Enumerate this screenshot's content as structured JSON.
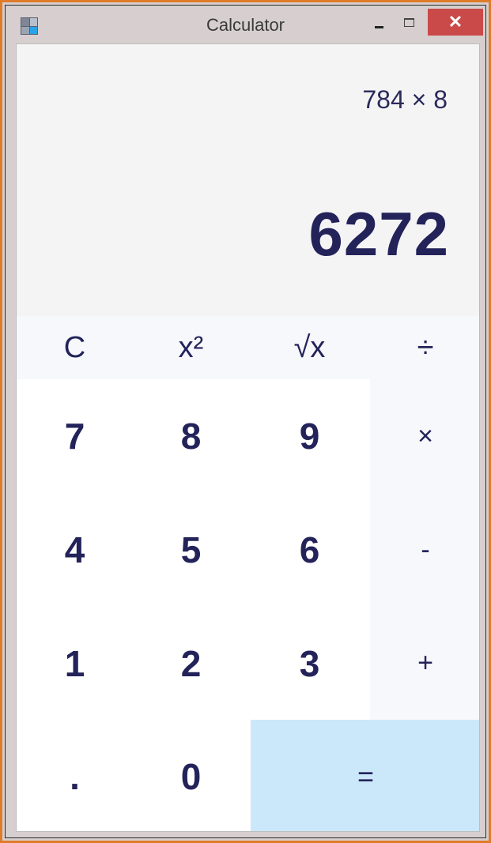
{
  "window": {
    "title": "Calculator",
    "close_label": "✕"
  },
  "display": {
    "expression": "784 × 8",
    "result": "6272"
  },
  "keys": {
    "clear": "C",
    "square": "x²",
    "sqrt": "√x",
    "divide": "÷",
    "multiply": "×",
    "minus": "-",
    "plus": "+",
    "equals": "=",
    "decimal": ".",
    "d0": "0",
    "d1": "1",
    "d2": "2",
    "d3": "3",
    "d4": "4",
    "d5": "5",
    "d6": "6",
    "d7": "7",
    "d8": "8",
    "d9": "9"
  },
  "colors": {
    "window_border": "#e07b2a",
    "titlebar": "#d7cfcf",
    "close_button": "#c94a48",
    "equals_key": "#cbe8fb",
    "text": "#23235a"
  },
  "icons": {
    "app": "calculator-icon",
    "minimize": "minimize-icon",
    "maximize": "maximize-icon",
    "close": "close-icon"
  }
}
